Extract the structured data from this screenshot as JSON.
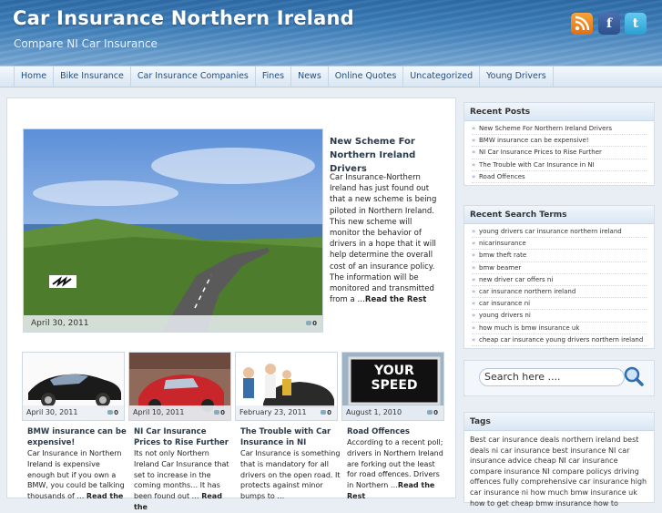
{
  "header": {
    "title": "Car Insurance Northern Ireland",
    "tagline": "Compare NI Car Insurance",
    "social": {
      "rss_icon": "rss-icon",
      "facebook_icon": "facebook-icon",
      "twitter_icon": "twitter-icon",
      "facebook_glyph": "f",
      "twitter_glyph": "t"
    }
  },
  "nav": {
    "items": [
      "Home",
      "Bike Insurance",
      "Car Insurance Companies",
      "Fines",
      "News",
      "Online Quotes",
      "Uncategorized",
      "Young Drivers"
    ]
  },
  "featured": {
    "title": "New Scheme For Northern Ireland Drivers",
    "excerpt": "Car Insurance-Northern Ireland has just found out that a new scheme is being piloted in Northern Ireland.  This new scheme will monitor the behavior of drivers in a hope that it will help determine the overall cost of an insurance policy. The information will be monitored and transmitted from a …",
    "read_more": "Read the Rest",
    "date": "April 30, 2011",
    "comments": "0"
  },
  "posts": [
    {
      "date": "April 30, 2011",
      "comments": "0",
      "title": "BMW insurance can be expensive!",
      "excerpt": "Car Insurance in Northern Ireland is expensive enough but if you own a BMW, you could be talking thousands of …",
      "read_more": "Read the"
    },
    {
      "date": "April 10, 2011",
      "comments": "0",
      "title": "NI Car Insurance Prices to Rise Further",
      "excerpt": "Its not only Northern Ireland Car Insurance that set to increase in the coming months… It has been found out …",
      "read_more": "Read the"
    },
    {
      "date": "February 23, 2011",
      "comments": "0",
      "title": "The Trouble with Car Insurance in NI",
      "excerpt": "Car Insurance is something that is mandatory for all drivers on the open road. It protects against minor bumps to …",
      "read_more": ""
    },
    {
      "date": "August 1, 2010",
      "comments": "0",
      "title": "Road Offences",
      "excerpt": "According to a recent poll; drivers in Northern Ireland are forking out the least for road offences.  Drivers in Northern …",
      "read_more": "Read the Rest",
      "sign_text": "YOUR SPEED"
    }
  ],
  "sidebar": {
    "recent_posts": {
      "title": "Recent Posts",
      "items": [
        "New Scheme For Northern Ireland Drivers",
        "BMW insurance can be expensive!",
        "NI Car Insurance Prices to Rise Further",
        "The Trouble with Car Insurance in NI",
        "Road Offences"
      ]
    },
    "search_terms": {
      "title": "Recent Search Terms",
      "items": [
        "young drivers car insurance northern ireland",
        "nicarinsurance",
        "bmw theft rate",
        "bmw beamer",
        "new driver car offers ni",
        "car insurance northern ireland",
        "car insurance ni",
        "young drivers ni",
        "how much is bmw insurance uk",
        "cheap car insurance young drivers northern ireland"
      ]
    },
    "search": {
      "value": "Search here ....",
      "icon": "magnifier-icon"
    },
    "tags": {
      "title": "Tags",
      "text": "Best car insurance deals northern ireland best deals ni car insurance best insurance NI car insurance advice cheap NI car insurance compare insurance NI compare policys driving offences fully comprehensive car insurance high car insurance ni how much bmw insurance uk how to get cheap bmw insurance how to"
    }
  },
  "colors": {
    "header": "#3e7fba",
    "nav_text": "#1f4f86",
    "accent": "#6a8ab0"
  }
}
